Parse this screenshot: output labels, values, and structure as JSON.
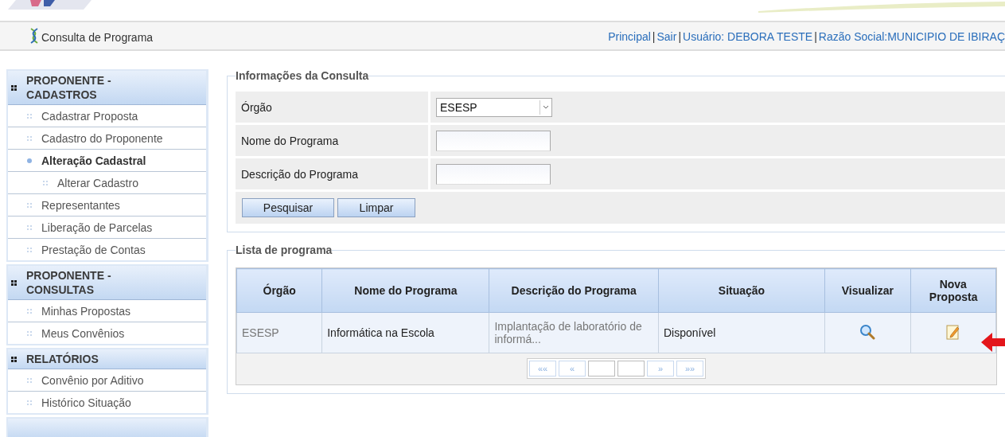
{
  "header": {
    "page_title": "Consulta de Programa",
    "links": [
      {
        "label": "Principal"
      },
      {
        "separator": "|",
        "label": "Sair"
      },
      {
        "separator": "|",
        "label": "Usuário: DEBORA TESTE"
      },
      {
        "separator": "|",
        "label": "Razão Social:MUNICIPIO DE IBIRAÇ"
      }
    ]
  },
  "sidebar": {
    "sections": [
      {
        "title": "PROPONENTE - CADASTROS",
        "items": [
          {
            "label": "Cadastrar Proposta",
            "selected": false
          },
          {
            "label": "Cadastro do Proponente",
            "selected": false
          },
          {
            "label": "Alteração Cadastral",
            "selected": true,
            "children": [
              {
                "label": "Alterar Cadastro",
                "selected": false
              }
            ]
          },
          {
            "label": "Representantes",
            "selected": false
          },
          {
            "label": "Liberação de Parcelas",
            "selected": false
          },
          {
            "label": "Prestação de Contas",
            "selected": false
          }
        ]
      },
      {
        "title": "PROPONENTE - CONSULTAS",
        "items": [
          {
            "label": "Minhas Propostas",
            "selected": false
          },
          {
            "label": "Meus Convênios",
            "selected": false
          }
        ]
      },
      {
        "title": "RELATÓRIOS",
        "items": [
          {
            "label": "Convênio por Aditivo",
            "selected": false
          },
          {
            "label": "Histórico Situação",
            "selected": false
          }
        ]
      }
    ]
  },
  "search": {
    "legend": "Informações da Consulta",
    "fields": [
      {
        "kind": "select",
        "label": "Órgão",
        "value": "ESESP"
      },
      {
        "kind": "text",
        "label": "Nome do Programa"
      },
      {
        "kind": "text",
        "label": "Descrição do Programa"
      }
    ],
    "buttons": [
      "Pesquisar",
      "Limpar"
    ]
  },
  "list": {
    "legend": "Lista de programa",
    "columns": [
      "Órgão",
      "Nome do Programa",
      "Descrição do Programa",
      "Situação",
      "Visualizar",
      "Nova Proposta"
    ],
    "rows": [
      {
        "orgao": "ESESP",
        "nome": "Informática na Escola",
        "descricao": "Implantação de laboratório de informá...",
        "situacao": "Disponível"
      }
    ],
    "pager": [
      {
        "kind": "first",
        "label": "««"
      },
      {
        "kind": "prev",
        "label": "«"
      },
      {
        "kind": "page"
      },
      {
        "kind": "page"
      },
      {
        "kind": "next",
        "label": "»"
      },
      {
        "kind": "last",
        "label": "»»"
      }
    ]
  }
}
